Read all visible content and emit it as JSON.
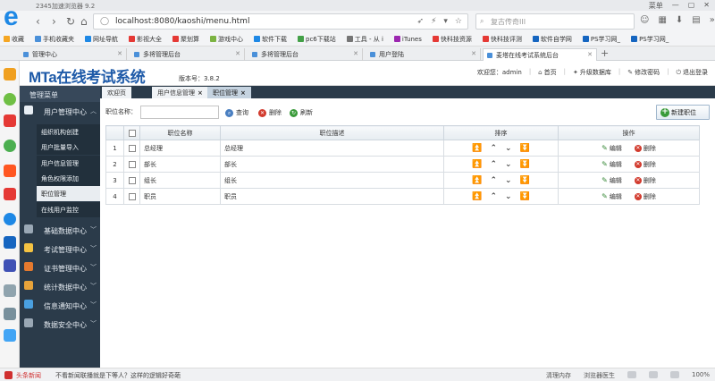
{
  "browser": {
    "title": "2345加速浏览器 9.2",
    "window_menu": "菜单",
    "url": "localhost:8080/kaoshi/menu.html",
    "search_placeholder": "复古传奇III",
    "bookmarks": [
      {
        "label": "收藏",
        "color": "#f5a623"
      },
      {
        "label": "手机收藏夹",
        "color": "#4a90d9"
      },
      {
        "label": "网址导航",
        "color": "#1e88e5"
      },
      {
        "label": "影视大全",
        "color": "#e53935"
      },
      {
        "label": "聚划算",
        "color": "#e53935"
      },
      {
        "label": "游戏中心",
        "color": "#7cb342"
      },
      {
        "label": "软件下载",
        "color": "#1e88e5"
      },
      {
        "label": "pc6下载站",
        "color": "#43a047"
      },
      {
        "label": "工具 - 从 i",
        "color": "#757575"
      },
      {
        "label": "iTunes",
        "color": "#9c27b0"
      },
      {
        "label": "快科技资源",
        "color": "#e53935"
      },
      {
        "label": "快科技评测",
        "color": "#e53935"
      },
      {
        "label": "软件自学网",
        "color": "#1565c0"
      },
      {
        "label": "PS学习网_",
        "color": "#1565c0"
      },
      {
        "label": "PS学习网_",
        "color": "#1565c0"
      }
    ],
    "tabs": [
      {
        "label": "管理中心"
      },
      {
        "label": "多将管理后台"
      },
      {
        "label": "多将管理后台"
      },
      {
        "label": "用户登陆"
      },
      {
        "label": "麦塔在线考试系统后台"
      }
    ],
    "status_bar": {
      "news_source": "头条新闻",
      "news": "不看新闻联播就是下等人？这样的逻辑好奇葩",
      "right_items": [
        "清理内存",
        "浏览器医生",
        "",
        "",
        "",
        "100%"
      ]
    }
  },
  "app": {
    "logo_text": "MTa在线考试系统",
    "version_label": "版本号：3.8.2",
    "top_links": {
      "welcome": "欢迎您：admin",
      "home": "首页",
      "upgrade": "升级数据库",
      "change_password": "修改密码",
      "logout": "退出登录"
    },
    "sidebar": {
      "title": "管理菜单",
      "groups": [
        {
          "label": "用户管理中心",
          "color": "#e8eef4"
        },
        {
          "label": "基础数据中心",
          "color": "#9aa8b5"
        },
        {
          "label": "考试管理中心",
          "color": "#f5c342"
        },
        {
          "label": "证书管理中心",
          "color": "#e57a2e"
        },
        {
          "label": "统计数据中心",
          "color": "#e8a33a"
        },
        {
          "label": "信息通知中心",
          "color": "#4aa0e0"
        },
        {
          "label": "数据安全中心",
          "color": "#9aa8b5"
        }
      ],
      "user_items": [
        {
          "label": "组织机构创建"
        },
        {
          "label": "用户批量导入"
        },
        {
          "label": "用户信息管理"
        },
        {
          "label": "角色权限添加"
        },
        {
          "label": "职位管理"
        },
        {
          "label": "在线用户监控"
        }
      ]
    },
    "content_tabs": [
      {
        "label": "欢迎页",
        "closable": ""
      },
      {
        "label": "用户信息管理",
        "closable": "×"
      },
      {
        "label": "职位管理",
        "closable": "×"
      }
    ],
    "toolbar": {
      "role_label": "职位名称：",
      "role_value": "",
      "query": "查询",
      "delete": "删除",
      "refresh": "刷新",
      "new_role": "新建职位"
    },
    "table": {
      "headers": {
        "name": "职位名称",
        "desc": "职位描述",
        "sort": "排序",
        "ops": "操作"
      },
      "edit_label": "编辑",
      "delete_label": "删除",
      "rows": [
        {
          "num": "1",
          "name": "总经理",
          "desc": "总经理"
        },
        {
          "num": "2",
          "name": "部长",
          "desc": "部长"
        },
        {
          "num": "3",
          "name": "组长",
          "desc": "组长"
        },
        {
          "num": "4",
          "name": "职员",
          "desc": "职员"
        }
      ]
    }
  }
}
